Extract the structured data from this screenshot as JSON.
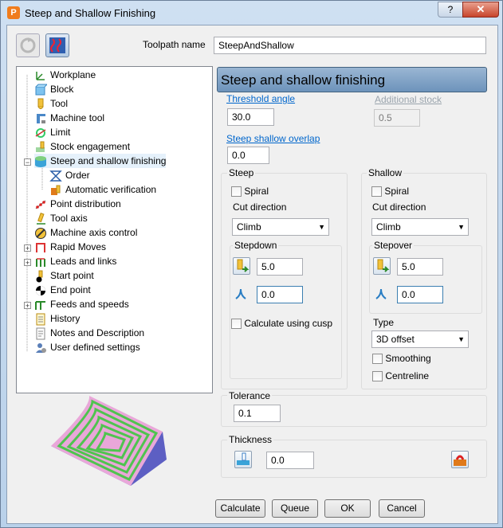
{
  "window": {
    "title": "Steep and Shallow Finishing",
    "help_label": "?",
    "close_label": "✕"
  },
  "toolpath_name": {
    "label": "Toolpath name",
    "value": "SteepAndShallow"
  },
  "tree": {
    "items": [
      {
        "label": "Workplane",
        "icon": "workplane-icon"
      },
      {
        "label": "Block",
        "icon": "block-icon"
      },
      {
        "label": "Tool",
        "icon": "tool-icon"
      },
      {
        "label": "Machine tool",
        "icon": "machine-tool-icon"
      },
      {
        "label": "Limit",
        "icon": "limit-icon"
      },
      {
        "label": "Stock engagement",
        "icon": "stock-engagement-icon"
      },
      {
        "label": "Steep and shallow finishing",
        "icon": "steep-shallow-icon"
      },
      {
        "label": "Order",
        "icon": "order-icon"
      },
      {
        "label": "Automatic verification",
        "icon": "verification-icon"
      },
      {
        "label": "Point distribution",
        "icon": "point-distribution-icon"
      },
      {
        "label": "Tool axis",
        "icon": "tool-axis-icon"
      },
      {
        "label": "Machine axis control",
        "icon": "machine-axis-icon"
      },
      {
        "label": "Rapid Moves",
        "icon": "rapid-moves-icon"
      },
      {
        "label": "Leads and links",
        "icon": "leads-links-icon"
      },
      {
        "label": "Start point",
        "icon": "start-point-icon"
      },
      {
        "label": "End point",
        "icon": "end-point-icon"
      },
      {
        "label": "Feeds and speeds",
        "icon": "feeds-speeds-icon"
      },
      {
        "label": "History",
        "icon": "history-icon"
      },
      {
        "label": "Notes and Description",
        "icon": "notes-icon"
      },
      {
        "label": "User defined settings",
        "icon": "user-settings-icon"
      }
    ]
  },
  "page_header": "Steep and shallow finishing",
  "threshold_angle": {
    "label": "Threshold angle",
    "value": "30.0"
  },
  "additional_stock": {
    "label": "Additional stock",
    "value": "0.5"
  },
  "overlap": {
    "label": "Steep shallow overlap",
    "value": "0.0"
  },
  "steep": {
    "title": "Steep",
    "spiral_label": "Spiral",
    "cut_direction_label": "Cut direction",
    "cut_direction_value": "Climb",
    "stepdown_title": "Stepdown",
    "stepdown_value": "5.0",
    "stepdown_min_value": "0.0",
    "cusp_label": "Calculate using cusp"
  },
  "shallow": {
    "title": "Shallow",
    "spiral_label": "Spiral",
    "cut_direction_label": "Cut direction",
    "cut_direction_value": "Climb",
    "stepover_title": "Stepover",
    "stepover_value": "5.0",
    "stepover_min_value": "0.0",
    "type_label": "Type",
    "type_value": "3D offset",
    "smoothing_label": "Smoothing",
    "centreline_label": "Centreline"
  },
  "tolerance": {
    "label": "Tolerance",
    "value": "0.1"
  },
  "thickness": {
    "label": "Thickness",
    "value": "0.0"
  },
  "buttons": {
    "calculate": "Calculate",
    "queue": "Queue",
    "ok": "OK",
    "cancel": "Cancel"
  },
  "colors": {
    "header_bg": "#7ea2c7",
    "link": "#0066cc",
    "preview_green": "#4fc44f",
    "preview_pink": "#e9a7d9"
  }
}
